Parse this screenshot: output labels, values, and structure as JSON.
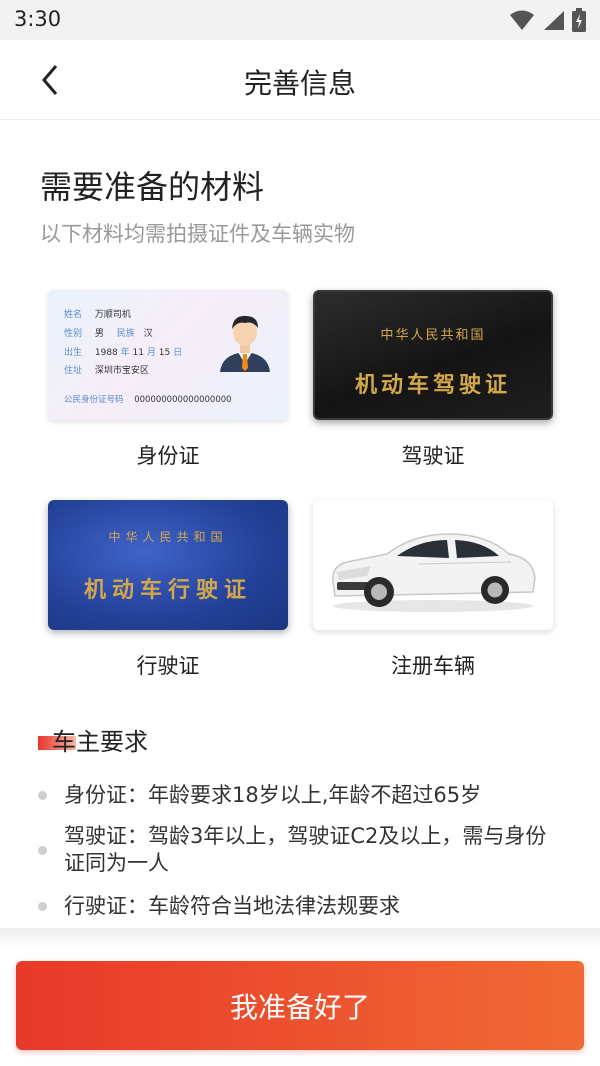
{
  "status_bar": {
    "time": "3:30"
  },
  "header": {
    "title": "完善信息"
  },
  "materials": {
    "title": "需要准备的材料",
    "subtitle": "以下材料均需拍摄证件及车辆实物",
    "cards": [
      {
        "label": "身份证"
      },
      {
        "label": "驾驶证"
      },
      {
        "label": "行驶证"
      },
      {
        "label": "注册车辆"
      }
    ],
    "id_card": {
      "name_key": "姓名",
      "name_value": "万顺司机",
      "gender_key": "性别",
      "gender_value": "男",
      "ethnicity_key": "民族",
      "ethnicity_value": "汉",
      "birth_key": "出生",
      "birth_year": "1988",
      "year_unit": "年",
      "birth_month": "11",
      "month_unit": "月",
      "birth_day": "15",
      "day_unit": "日",
      "address_key": "住址",
      "address_value": "深圳市宝安区",
      "number_key": "公民身份证号码",
      "number_value": "000000000000000000"
    },
    "driver_license": {
      "country": "中华人民共和国",
      "name": "机动车驾驶证"
    },
    "vehicle_license": {
      "country": "中华人民共和国",
      "name": "机动车行驶证"
    }
  },
  "owner_requirements": {
    "title": "车主要求",
    "items": [
      "身份证：年龄要求18岁以上,年龄不超过65岁",
      "驾驶证：驾龄3年以上，驾驶证C2及以上，需与身份证同为一人",
      "行驶证：车龄符合当地法律法规要求"
    ]
  },
  "footer": {
    "button_label": "我准备好了"
  },
  "colors": {
    "accent_start": "#e8392a",
    "accent_end": "#f06a33",
    "gold": "#d3a84a",
    "vehicle_blue": "#234198"
  }
}
